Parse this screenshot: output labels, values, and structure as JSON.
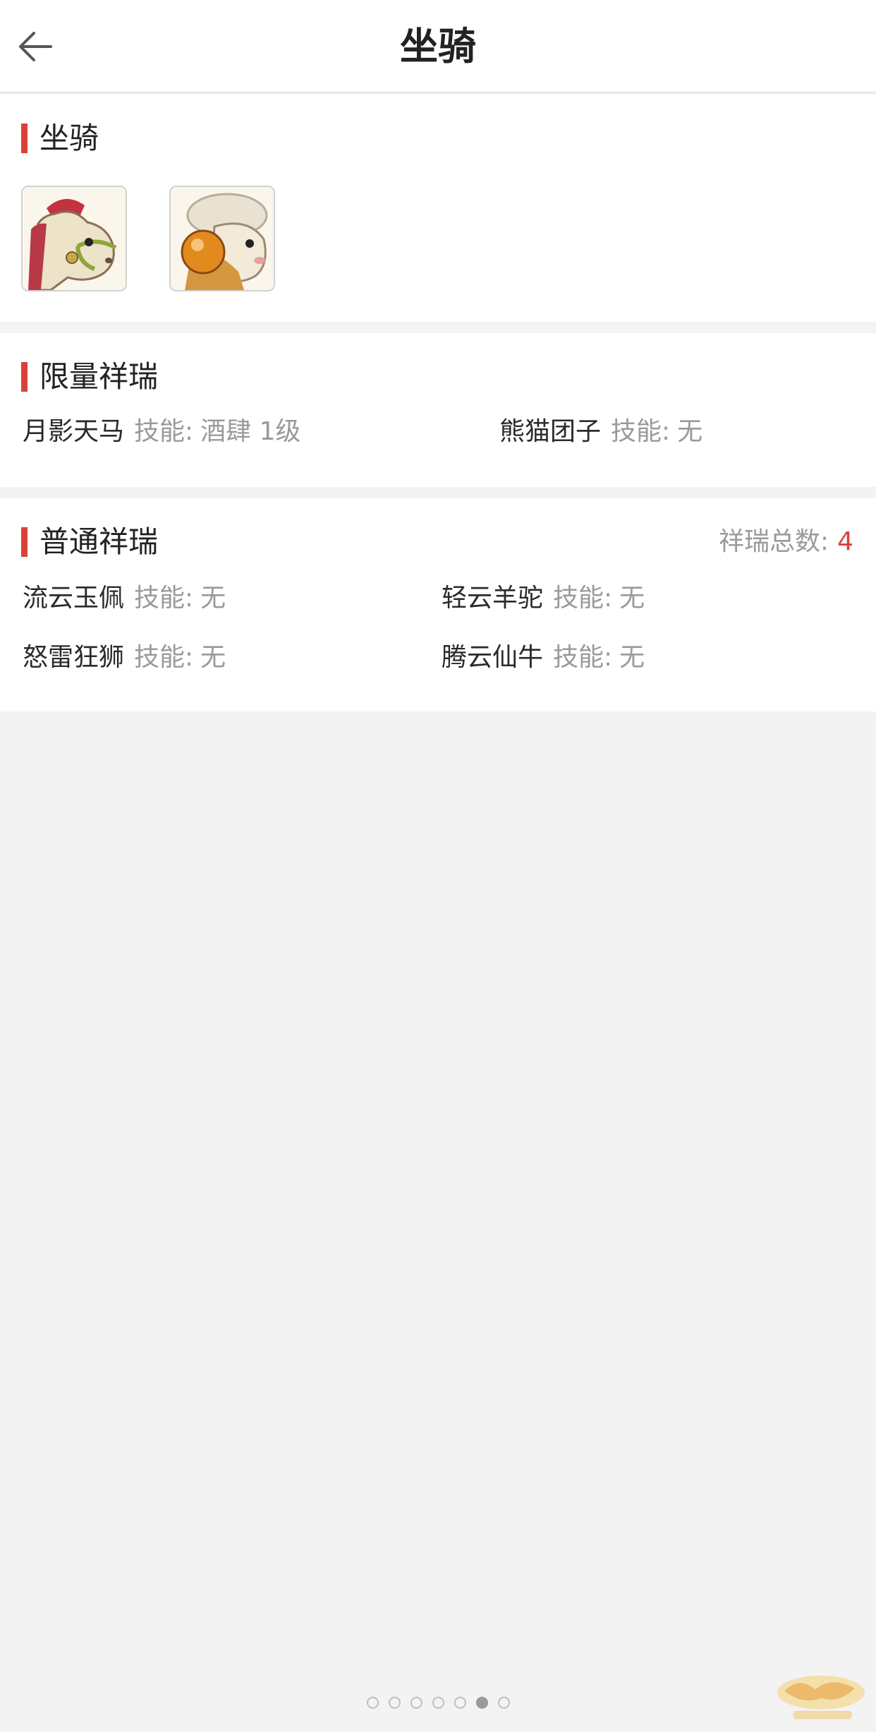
{
  "header": {
    "title": "坐骑",
    "back_icon": "arrow-left-icon"
  },
  "mounts": {
    "title": "坐骑",
    "items": [
      {
        "icon": "horse-mount-icon"
      },
      {
        "icon": "sheep-mount-icon"
      }
    ]
  },
  "limited": {
    "title": "限量祥瑞",
    "items": [
      {
        "name": "月影天马",
        "skill_label": "技能:",
        "skill": "酒肆 1级"
      },
      {
        "name": "熊猫团子",
        "skill_label": "技能:",
        "skill": "无"
      }
    ]
  },
  "common": {
    "title": "普通祥瑞",
    "total_label": "祥瑞总数:",
    "total": "4",
    "items": [
      {
        "name": "流云玉佩",
        "skill_label": "技能:",
        "skill": "无"
      },
      {
        "name": "轻云羊驼",
        "skill_label": "技能:",
        "skill": "无"
      },
      {
        "name": "怒雷狂狮",
        "skill_label": "技能:",
        "skill": "无"
      },
      {
        "name": "腾云仙牛",
        "skill_label": "技能:",
        "skill": "无"
      }
    ]
  },
  "pagination": {
    "count": 7,
    "active_index": 5
  },
  "watermark": {
    "icon": "game-logo-watermark"
  },
  "colors": {
    "accent": "#d8423a",
    "muted": "#9a9a9a",
    "background": "#f3f3f3"
  }
}
